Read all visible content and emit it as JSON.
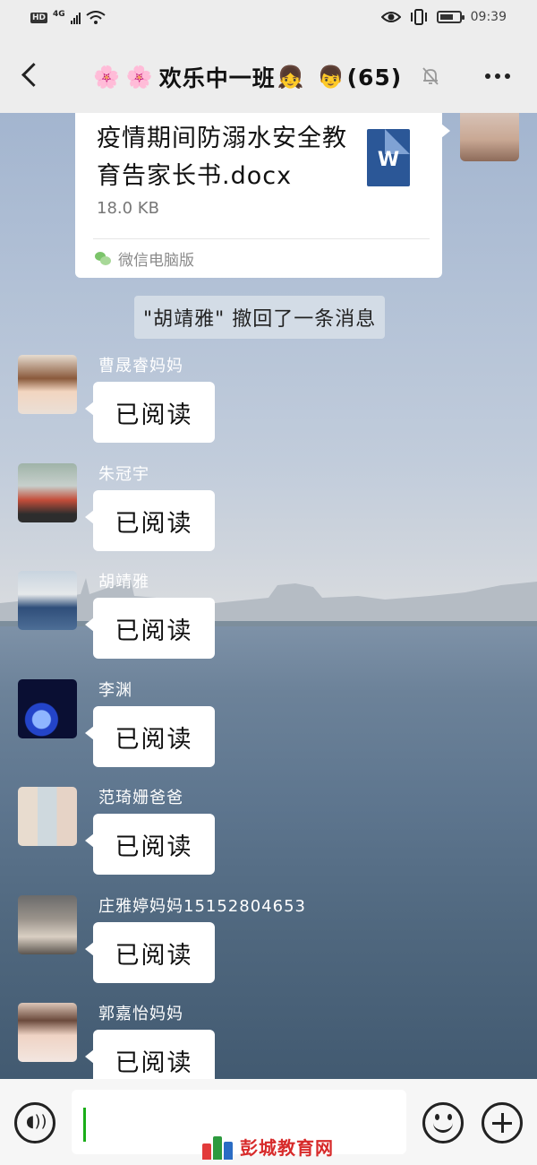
{
  "status_bar": {
    "hd": "HD",
    "network": "4G",
    "time": "09:39",
    "icons": [
      "hd-icon",
      "signal-icon",
      "wifi-icon",
      "eye-icon",
      "vibrate-icon",
      "battery-icon"
    ]
  },
  "nav": {
    "title_emoji_1": "🌸",
    "title_emoji_2": "🌸",
    "title_text": "欢乐中一班",
    "title_emoji_3": "👧",
    "title_emoji_4": "👦",
    "member_count": "(65)",
    "icons": [
      "back-icon",
      "mute-bell-icon",
      "more-icon"
    ]
  },
  "file_message": {
    "file_name": "疫情期间防溺水安全教育告家长书.docx",
    "file_size": "18.0 KB",
    "file_type_letter": "W",
    "source": "微信电脑版"
  },
  "recall_notice": "\"胡靖雅\" 撤回了一条消息",
  "messages": [
    {
      "sender": "曹晟睿妈妈",
      "text": "已阅读"
    },
    {
      "sender": "朱冠宇",
      "text": "已阅读"
    },
    {
      "sender": "胡靖雅",
      "text": "已阅读"
    },
    {
      "sender": "李渊",
      "text": "已阅读"
    },
    {
      "sender": "范琦姗爸爸",
      "text": "已阅读"
    },
    {
      "sender": "庄雅婷妈妈15152804653",
      "text": "已阅读"
    },
    {
      "sender": "郭嘉怡妈妈",
      "text": "已阅读"
    }
  ],
  "input_bar": {
    "value": "",
    "icons": [
      "voice-icon",
      "emoji-icon",
      "plus-icon"
    ]
  },
  "watermark": "彭城教育网",
  "colors": {
    "wechat_green": "#1aad19",
    "word_blue": "#2b5797",
    "watermark_red": "#d72a2a"
  }
}
